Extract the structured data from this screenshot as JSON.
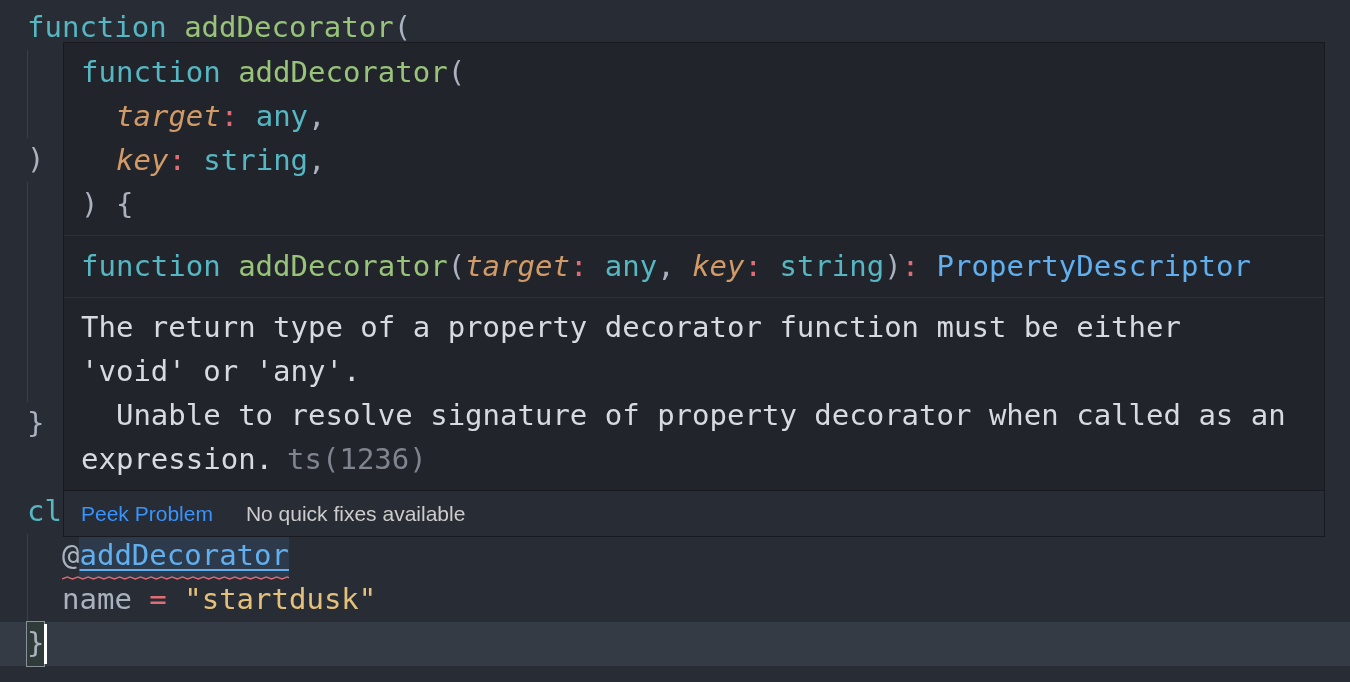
{
  "editor": {
    "lines": [
      {
        "indent_guide": false,
        "current": false,
        "tokens": [
          {
            "text": "function",
            "kind": "keyword"
          },
          {
            "text": " addDecorator",
            "kind": "function"
          },
          {
            "text": "(",
            "kind": "punct"
          }
        ]
      },
      {
        "indent_guide": true,
        "current": false
      },
      {
        "indent_guide": true,
        "current": false
      },
      {
        "indent_guide": false,
        "current": false,
        "tokens": [
          {
            "text": ")",
            "kind": "punct"
          }
        ]
      },
      {
        "indent_guide": true,
        "current": false
      },
      {
        "indent_guide": true,
        "current": false
      },
      {
        "indent_guide": true,
        "current": false
      },
      {
        "indent_guide": true,
        "current": false
      },
      {
        "indent_guide": true,
        "current": false
      },
      {
        "indent_guide": false,
        "current": false,
        "tokens": [
          {
            "text": "}",
            "kind": "punct"
          }
        ]
      },
      {
        "indent_guide": false,
        "current": false
      },
      {
        "indent_guide": false,
        "current": false,
        "tokens": [
          {
            "text": "cl",
            "kind": "keyword"
          }
        ]
      },
      {
        "indent_guide": true,
        "current": false,
        "indented": true,
        "tokens": [
          {
            "text": "@",
            "kind": "plain"
          },
          {
            "text": "addDecorator",
            "kind": "error_link"
          }
        ]
      },
      {
        "indent_guide": true,
        "current": false,
        "indented": true,
        "tokens": [
          {
            "text": "name",
            "kind": "plain"
          },
          {
            "text": " =",
            "kind": "operator"
          },
          {
            "text": " \"startdusk\"",
            "kind": "string"
          }
        ]
      },
      {
        "indent_guide": false,
        "current": true,
        "tokens": [
          {
            "text": "}",
            "kind": "bracket_match"
          }
        ]
      }
    ]
  },
  "hover": {
    "code_lines": [
      {
        "indented": false,
        "tokens": [
          {
            "text": "function",
            "kind": "keyword"
          },
          {
            "text": " addDecorator",
            "kind": "function"
          },
          {
            "text": "(",
            "kind": "punct"
          }
        ]
      },
      {
        "indented": true,
        "tokens": [
          {
            "text": "target",
            "kind": "param"
          },
          {
            "text": ":",
            "kind": "operator"
          },
          {
            "text": " any",
            "kind": "type"
          },
          {
            "text": ",",
            "kind": "punct"
          }
        ]
      },
      {
        "indented": true,
        "tokens": [
          {
            "text": "key",
            "kind": "param"
          },
          {
            "text": ":",
            "kind": "operator"
          },
          {
            "text": " string",
            "kind": "type"
          },
          {
            "text": ",",
            "kind": "punct"
          }
        ]
      },
      {
        "indented": false,
        "tokens": [
          {
            "text": ")",
            "kind": "punct"
          },
          {
            "text": " {",
            "kind": "punct"
          }
        ]
      }
    ],
    "signature": [
      {
        "text": "function",
        "kind": "keyword"
      },
      {
        "text": " addDecorator",
        "kind": "function"
      },
      {
        "text": "(",
        "kind": "punct"
      },
      {
        "text": "target",
        "kind": "param"
      },
      {
        "text": ":",
        "kind": "operator"
      },
      {
        "text": " any",
        "kind": "type"
      },
      {
        "text": ",",
        "kind": "punct"
      },
      {
        "text": " key",
        "kind": "param"
      },
      {
        "text": ":",
        "kind": "operator"
      },
      {
        "text": " string",
        "kind": "type"
      },
      {
        "text": ")",
        "kind": "punct"
      },
      {
        "text": ":",
        "kind": "operator"
      },
      {
        "text": " PropertyDescriptor",
        "kind": "type_ref"
      }
    ],
    "message": {
      "lines": [
        "The return type of a property decorator function must be either",
        "'void' or 'any'.",
        "  Unable to resolve signature of property decorator when called as an",
        "expression."
      ],
      "code": "ts(1236)"
    },
    "actions": [
      {
        "label": "Peek Problem",
        "kind": "link"
      },
      {
        "label": "No quick fixes available",
        "kind": "note"
      }
    ]
  }
}
